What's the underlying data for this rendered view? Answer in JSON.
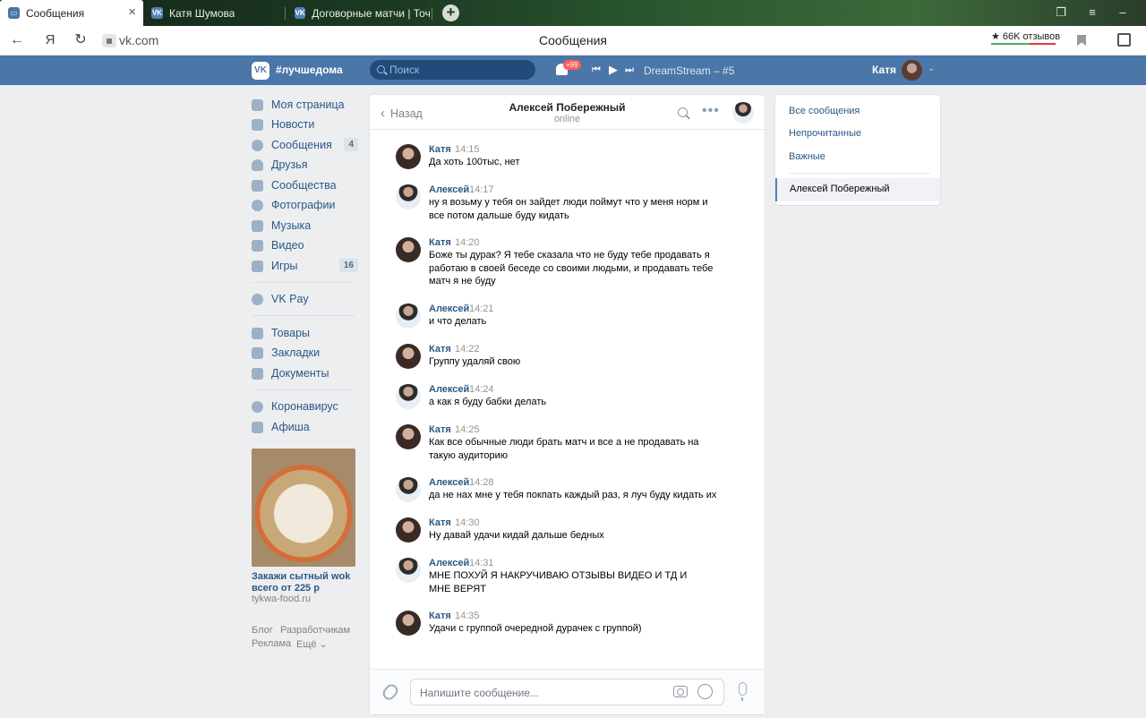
{
  "browser": {
    "tabs": [
      {
        "title": "Сообщения",
        "active": true
      },
      {
        "title": "Катя Шумова",
        "active": false
      },
      {
        "title": "Договорные матчи | Точн",
        "active": false
      }
    ],
    "url": "vk.com",
    "page_title": "Сообщения",
    "reviews": "★ 66K отзывов",
    "yandex": "Я"
  },
  "vk": {
    "brand": "#лучшедома",
    "search_placeholder": "Поиск",
    "notifications_badge": "+99",
    "track": "DreamStream – #5",
    "user": "Катя"
  },
  "menu": {
    "items": [
      {
        "label": "Моя страница",
        "count": ""
      },
      {
        "label": "Новости",
        "count": ""
      },
      {
        "label": "Сообщения",
        "count": "4"
      },
      {
        "label": "Друзья",
        "count": ""
      },
      {
        "label": "Сообщества",
        "count": ""
      },
      {
        "label": "Фотографии",
        "count": ""
      },
      {
        "label": "Музыка",
        "count": ""
      },
      {
        "label": "Видео",
        "count": ""
      },
      {
        "label": "Игры",
        "count": "16"
      }
    ],
    "pay": "VK Pay",
    "shop": [
      "Товары",
      "Закладки",
      "Документы"
    ],
    "extra": [
      "Коронавирус",
      "Афиша"
    ]
  },
  "ad": {
    "title": "Закажи сытный wok всего от 225 р",
    "site": "tykwa-food.ru"
  },
  "footer": {
    "links": [
      "Блог",
      "Разработчикам",
      "Реклама",
      "Ещё ⌄"
    ]
  },
  "chat": {
    "back": "Назад",
    "contact_name": "Алексей Побережный",
    "contact_status": "online",
    "input_placeholder": "Напишите сообщение...",
    "messages": [
      {
        "author": "Катя",
        "time": "14:15",
        "text": "Да хоть 100тыс, нет"
      },
      {
        "author": "Алексей",
        "time": "14:17",
        "text": "ну я возьму у тебя он зайдет люди поймут что у меня норм и все потом дальше буду кидать"
      },
      {
        "author": "Катя",
        "time": "14:20",
        "text": "Боже ты дурак? Я тебе сказала что не буду тебе продавать я работаю в своей беседе со своими людьми, и продавать тебе матч я не буду"
      },
      {
        "author": "Алексей",
        "time": "14:21",
        "text": "и что делать"
      },
      {
        "author": "Катя",
        "time": "14:22",
        "text": "Группу удаляй свою"
      },
      {
        "author": "Алексей",
        "time": "14:24",
        "text": "а как я буду бабки делать"
      },
      {
        "author": "Катя",
        "time": "14:25",
        "text": "Как все обычные люди брать матч и все а не продавать на такую аудиторию"
      },
      {
        "author": "Алексей",
        "time": "14:28",
        "text": "да не нах мне у тебя покпать каждый раз, я луч буду кидать их"
      },
      {
        "author": "Катя",
        "time": "14:30",
        "text": "Ну давай удачи кидай дальше бедных"
      },
      {
        "author": "Алексей",
        "time": "14:31",
        "text": "МНЕ ПОХУЙ Я НАКРУЧИВАЮ ОТЗЫВЫ ВИДЕО И ТД И МНЕ ВЕРЯТ"
      },
      {
        "author": "Катя",
        "time": "14:35",
        "text": "Удачи с группой очередной дурачек с группой)"
      }
    ]
  },
  "right_panel": {
    "filters": [
      "Все сообщения",
      "Непрочитанные",
      "Важные"
    ],
    "active_dialog": "Алексей Побережный"
  },
  "colors": {
    "vk_blue": "#4a76a8",
    "link": "#2a5885",
    "page_bg": "#edeef0"
  }
}
